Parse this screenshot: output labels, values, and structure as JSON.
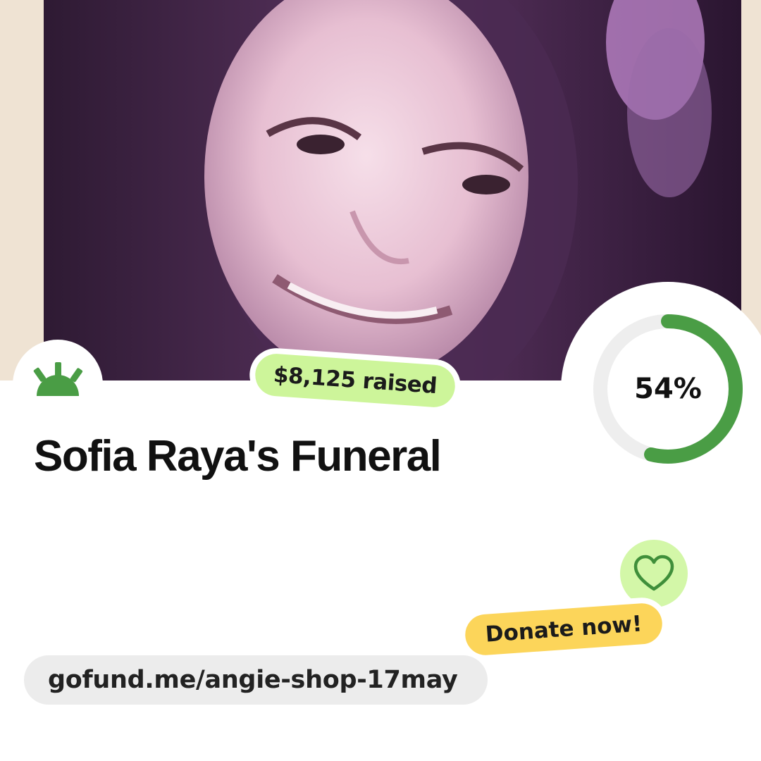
{
  "campaign": {
    "raised_text": "$8,125 raised",
    "progress": 0.54,
    "progress_text": "54%",
    "title": "Sofia Raya's Funeral",
    "donate_label": "Donate now!",
    "url": "gofund.me/angie-shop-17may"
  },
  "icons": {
    "logo": "gofundme-sunrise-icon",
    "heart": "heart-icon"
  },
  "colors": {
    "brand_green": "#4a9d45",
    "raised_bg": "#cdf59a",
    "donate_bg": "#fcd55a",
    "heart_bg": "#d3f7a8",
    "progress_track": "#eeeeee",
    "url_bg": "#ececec"
  }
}
